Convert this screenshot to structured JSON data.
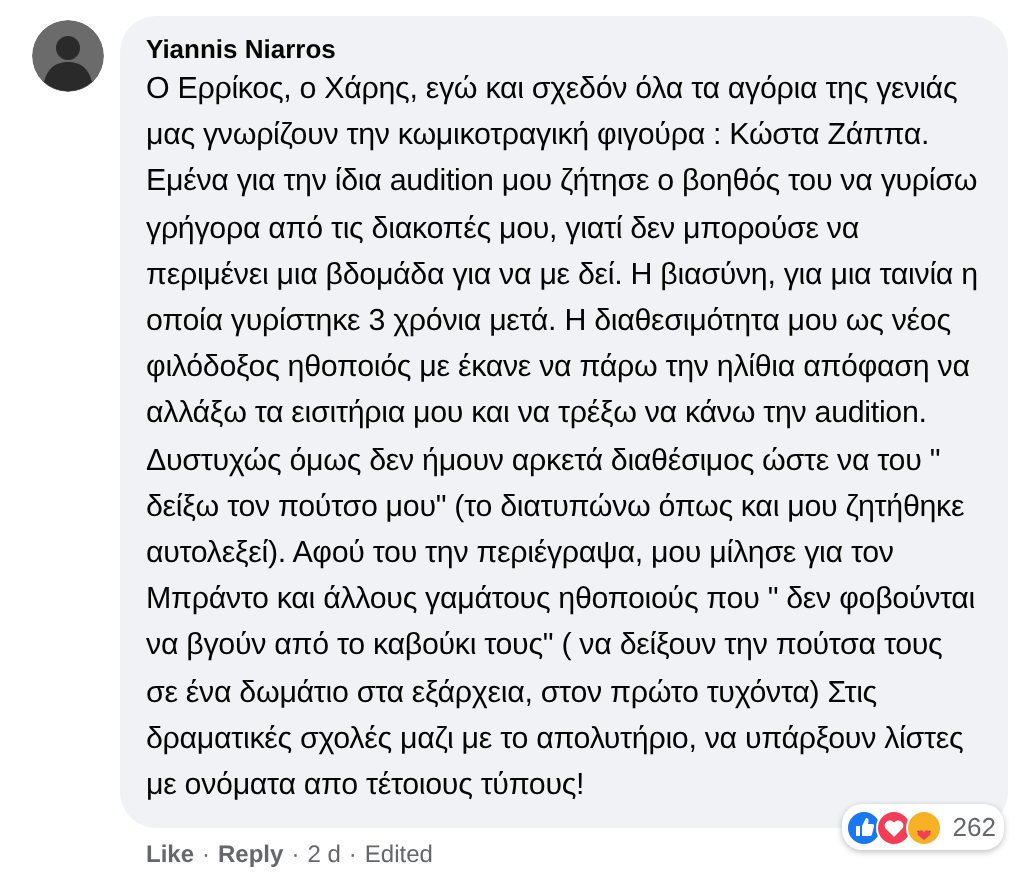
{
  "comment": {
    "author": "Yiannis Niarros",
    "text": "Ο Ερρίκος, ο Χάρης, εγώ και σχεδόν όλα τα αγόρια της γενιάς μας γνωρίζουν την κωμικοτραγική φιγούρα : Κώστα Ζάππα. Εμένα για την ίδια audition μου ζήτησε ο βοηθός του να γυρίσω γρήγορα από τις διακοπές μου, γιατί δεν μπορούσε να περιμένει μια βδομάδα για να με δεί. Η βιασύνη, για μια ταινία η οποία γυρίστηκε 3 χρόνια μετά. Η διαθεσιμότητα μου ως νέος φιλόδοξος ηθοποιός με έκανε να πάρω την ηλίθια απόφαση να αλλάξω τα εισιτήρια μου και να τρέξω να κάνω την audition. Δυστυχώς όμως δεν ήμουν αρκετά διαθέσιμος ώστε να του \" δείξω τον πούτσο μου\" (το διατυπώνω όπως και μου ζητήθηκε αυτολεξεί). Αφού του την περιέγραψα, μου μίλησε για τον Μπράντο και άλλους γαμάτους ηθοποιούς που \" δεν φοβούνται να βγούν από το καβούκι τους\" ( να δείξουν την πούτσα τους σε ένα δωμάτιο στα εξάρχεια, στον πρώτο τυχόντα) Στις δραματικές σχολές μαζι με το απολυτήριο, να υπάρξουν λίστες με ονόματα απο τέτοιους τύπους!",
    "reactions": {
      "icons": [
        {
          "kind": "like"
        },
        {
          "kind": "love"
        },
        {
          "kind": "care"
        }
      ],
      "count": "262"
    },
    "separator": "·",
    "footer": [
      {
        "kind": "link",
        "text": "Like"
      },
      {
        "kind": "link",
        "text": "Reply"
      },
      {
        "kind": "info",
        "text": "2 d"
      },
      {
        "kind": "info",
        "text": "Edited"
      }
    ]
  }
}
